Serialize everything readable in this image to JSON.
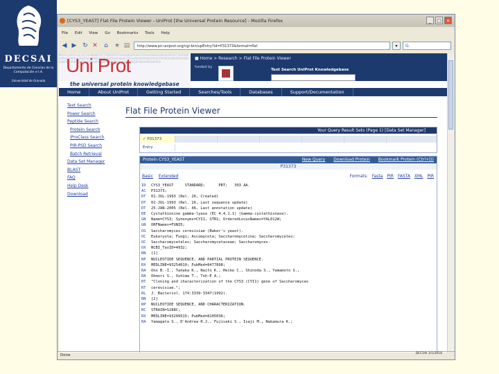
{
  "logo": {
    "acronym": "DECSAI",
    "subtitle": "Departamento de Ciencias de la Computación e I.A.",
    "university": "Universidad de Granada"
  },
  "browser": {
    "title": "[CYS3_YEAST] Flat File Protein Viewer - UniProt [the Universal Protein Resource] - Mozilla Firefox",
    "menu": [
      "File",
      "Edit",
      "View",
      "Go",
      "Bookmarks",
      "Tools",
      "Help"
    ],
    "url": "http://www.pir.uniprot.org/cgi-bin/upEntry?id=P31373&format=flat",
    "search_placeholder": "G.",
    "status": "Done",
    "status_right": "DECSAI 3/1/2018"
  },
  "banner": {
    "logo_text": "Uni Prot",
    "tagline": "the universal protein knowledgebase",
    "breadcrumb": "■ Home > Research > Flat File Protein Viewer",
    "funded_by": "funded by",
    "kb_label": "Text Search UniProt Knowledgebase",
    "pattern": "MKVALLAVVLLGLSACSSSDDKKESSTTEVKAPEVTAAPAAKAEPKAEVTAPAAAPAKEEAPKAEEKPAATTEAPAAKAEPAAEKAPEAAAEKPAEAAPKEEAKPAAEAPKAEEKKAEETPAAPAAEAPAAKAEPAAETKAPEAAAEKPAEAAPKEEAKPAAEAPKAEEKKAEETPAAPAAEAPAAKAEPAAETKAPEAAAEKPAEAAPKEEAKPAA"
  },
  "topnav": [
    "Home",
    "About UniProt",
    "Getting Started",
    "Searches/Tools",
    "Databases",
    "Support/Documentation"
  ],
  "sidenav": [
    {
      "label": "Text Search",
      "sub": false
    },
    {
      "label": "Power Search",
      "sub": false
    },
    {
      "label": "Peptide Search",
      "sub": false
    },
    {
      "label": "Protein Search",
      "sub": true
    },
    {
      "label": "iProClass Search",
      "sub": true
    },
    {
      "label": "PIR-PSD Search",
      "sub": true
    },
    {
      "label": "Batch Retrieval",
      "sub": true
    },
    {
      "label": "Data Set Manager",
      "sub": false
    },
    {
      "label": "BLAST",
      "sub": false
    },
    {
      "label": "FAQ",
      "sub": false
    },
    {
      "label": "Help Desk",
      "sub": false
    },
    {
      "label": "Download",
      "sub": false
    }
  ],
  "page": {
    "title": "Flat File Protein Viewer"
  },
  "query_box": {
    "header": "Your Query Result Sets (Page  1) [Data Set Manager]",
    "tag": "P31373",
    "row2": "Entry"
  },
  "protein_box": {
    "header_left": "Protein CYS3_YEAST",
    "actions": [
      "New Query",
      "Download Protein",
      "Bookmark Protein (Ctrl+D)"
    ],
    "accession": "P31373",
    "tabs": [
      "Basic",
      "Extended"
    ],
    "formats_label": "Formats:",
    "formats": [
      "Fasta",
      "PIR",
      "FASTA",
      "XML",
      "PIR"
    ],
    "lines": [
      {
        "code": "ID",
        "text": "CYS3_YEAST     STANDARD;      PRT;   393 AA."
      },
      {
        "code": "AC",
        "text": "P31373;"
      },
      {
        "code": "DT",
        "text": "01-JUL-1993 (Rel. 26, Created)"
      },
      {
        "code": "DT",
        "text": "01-JUL-1993 (Rel. 26, Last sequence update)"
      },
      {
        "code": "DT",
        "text": "25-JAN-2005 (Rel. 46, Last annotation update)"
      },
      {
        "code": "DE",
        "text": "Cystathionine gamma-lyase (EC 4.4.1.1) (Gamma-cystathionase)."
      },
      {
        "code": "GN",
        "text": "Name=CYS3; Synonyms=CYI1, STR1; OrderedLocusNames=YAL012W;"
      },
      {
        "code": "GN",
        "text": "ORFNames=FUN35;"
      },
      {
        "code": "OS",
        "text": "Saccharomyces cerevisiae (Baker's yeast)."
      },
      {
        "code": "OC",
        "text": "Eukaryota; Fungi; Ascomycota; Saccharomycotina; Saccharomycetes;"
      },
      {
        "code": "OC",
        "text": "Saccharomycetales; Saccharomycetaceae; Saccharomyces."
      },
      {
        "code": "OX",
        "text": "NCBI_TaxID=4932;"
      },
      {
        "code": "RN",
        "text": "[1]"
      },
      {
        "code": "RP",
        "text": "NUCLEOTIDE SEQUENCE, AND PARTIAL PROTEIN SEQUENCE."
      },
      {
        "code": "RX",
        "text": "MEDLINE=93254010; PubMed=8477898;"
      },
      {
        "code": "RA",
        "text": "Ono B.-I., Tanaka K., Naito K., Heike C., Shinoda S., Yamamoto S.,"
      },
      {
        "code": "RA",
        "text": "Ohmori S., Oshima T., Toh-E A.;"
      },
      {
        "code": "RT",
        "text": "\"Cloning and characterization of the CYS3 (CYI1) gene of Saccharomyces"
      },
      {
        "code": "RT",
        "text": "cerevisiae.\";"
      },
      {
        "code": "RL",
        "text": "J. Bacteriol. 174:3339-3347(1992)."
      },
      {
        "code": "RN",
        "text": "[2]"
      },
      {
        "code": "RP",
        "text": "NUCLEOTIDE SEQUENCE, AND CHARACTERIZATION."
      },
      {
        "code": "RC",
        "text": "STRAIN=S288C;"
      },
      {
        "code": "RX",
        "text": "MEDLINE=93209515; PubMed=8105036;"
      },
      {
        "code": "RA",
        "text": "Yamagata S., D'Andrea R.J., Fujisaki S., Isaji M., Nakamura K.;"
      }
    ]
  }
}
